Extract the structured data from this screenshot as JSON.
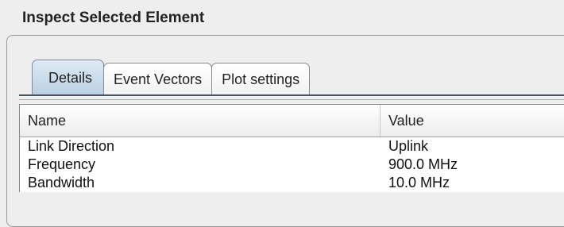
{
  "panel": {
    "title": "Inspect Selected Element"
  },
  "tabs": [
    {
      "label": "Details",
      "active": true
    },
    {
      "label": "Event Vectors",
      "active": false
    },
    {
      "label": "Plot settings",
      "active": false
    }
  ],
  "table": {
    "headers": {
      "name": "Name",
      "value": "Value"
    },
    "rows": [
      {
        "name": "Link Direction",
        "value": "Uplink"
      },
      {
        "name": "Frequency",
        "value": "900.0 MHz"
      },
      {
        "name": "Bandwidth",
        "value": "10.0 MHz"
      }
    ]
  }
}
